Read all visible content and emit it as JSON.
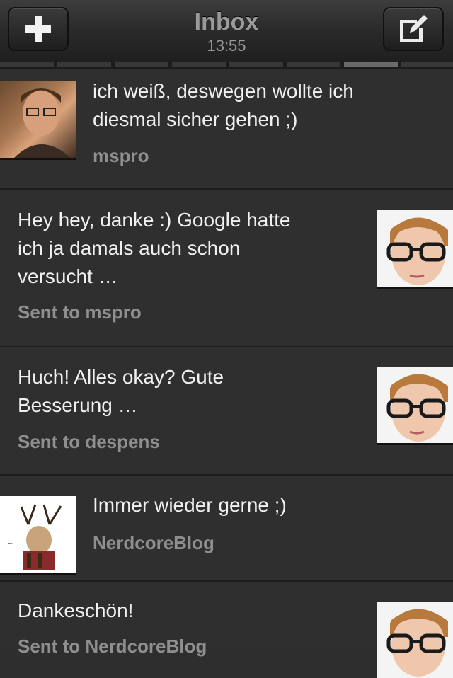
{
  "header": {
    "title": "Inbox",
    "time": "13:55",
    "add_icon": "plus-icon",
    "compose_icon": "compose-icon"
  },
  "pager": {
    "pages": 8,
    "active_index": 6
  },
  "messages": [
    {
      "text_lines": [
        "ich weiß, deswegen wollte ich",
        "diesmal sicher gehen ;)"
      ],
      "meta": "mspro",
      "avatar": "user-photo-mspro"
    },
    {
      "text_lines": [
        "Hey hey, danke :) Google hatte",
        "ich ja damals auch schon",
        "versucht …"
      ],
      "meta": "Sent to mspro",
      "avatar": "user-photo-self"
    },
    {
      "text_lines": [
        "Huch! Alles okay? Gute",
        "Besserung …"
      ],
      "meta": "Sent to despens",
      "avatar": "user-photo-self"
    },
    {
      "text_lines": [
        "Immer wieder gerne ;)"
      ],
      "meta": "NerdcoreBlog",
      "avatar": "nerdcore-logo"
    },
    {
      "text_lines": [
        "Dankeschön!"
      ],
      "meta": "Sent to NerdcoreBlog",
      "avatar": "user-photo-self"
    }
  ]
}
